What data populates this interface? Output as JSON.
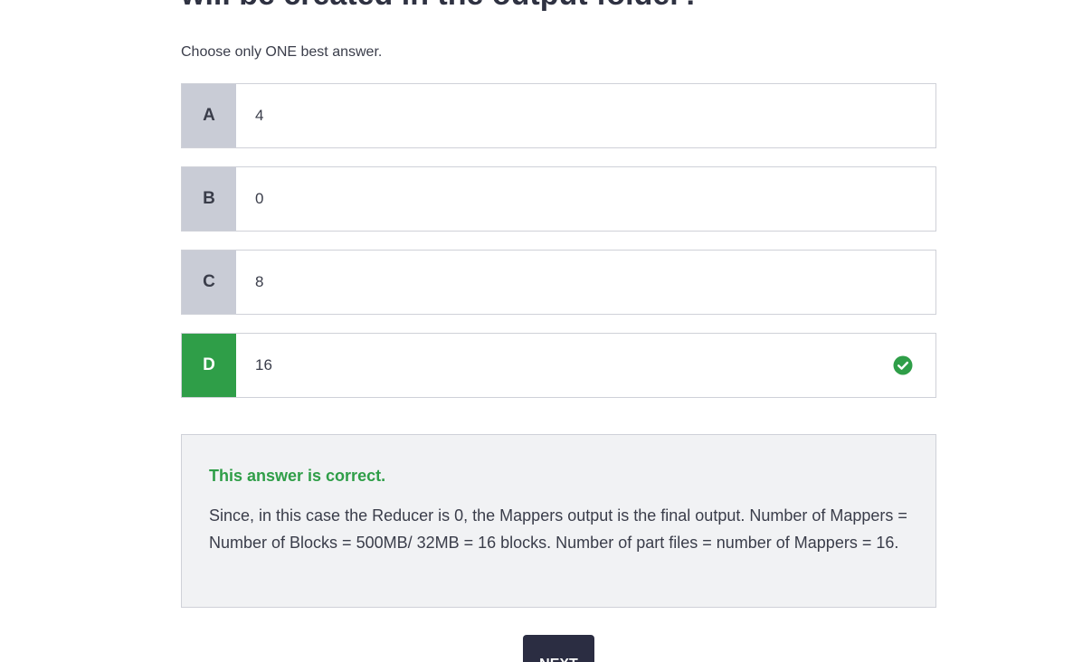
{
  "question": {
    "title_visible_fragment": "will be created in the output folder?",
    "instruction": "Choose only ONE best answer."
  },
  "options": [
    {
      "letter": "A",
      "text": "4",
      "state": "default"
    },
    {
      "letter": "B",
      "text": "0",
      "state": "default"
    },
    {
      "letter": "C",
      "text": "8",
      "state": "default"
    },
    {
      "letter": "D",
      "text": "16",
      "state": "correct"
    }
  ],
  "feedback": {
    "status": "This answer is correct.",
    "explanation": "Since, in this case the Reducer is 0, the Mappers output is the final output. Number of Mappers = Number of Blocks = 500MB/ 32MB = 16 blocks. Number of part files = number of Mappers = 16."
  },
  "next_button": {
    "label": "NEXT"
  },
  "colors": {
    "correct_green": "#2f9e48",
    "letter_bg": "#c9ccd6",
    "button_bg": "#2b2d42",
    "feedback_bg": "#f1f2f4"
  },
  "icons": {
    "correct": "check-circle-icon"
  }
}
